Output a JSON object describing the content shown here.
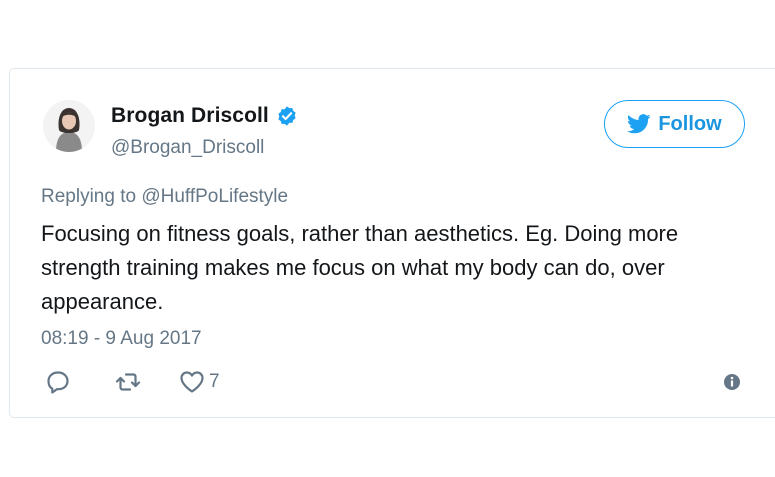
{
  "author": {
    "name": "Brogan Driscoll",
    "handle": "@Brogan_Driscoll",
    "verified_icon": "verified-badge-icon"
  },
  "follow_button": {
    "label": "Follow",
    "icon": "twitter-bird-icon"
  },
  "tweet": {
    "reply_prefix": "Replying to ",
    "reply_to": "@HuffPoLifestyle",
    "text": "Focusing on fitness goals, rather than aesthetics. Eg. Doing more strength training makes me focus on what my body can do, over appearance.",
    "timestamp": "08:19 - 9 Aug 2017"
  },
  "actions": {
    "reply_icon": "reply-icon",
    "retweet_icon": "retweet-icon",
    "like_icon": "heart-icon",
    "like_count": "7",
    "info_icon": "info-icon"
  },
  "colors": {
    "accent": "#1da1f2",
    "text": "#14171a",
    "muted": "#657786",
    "border": "#e1e8ed"
  }
}
